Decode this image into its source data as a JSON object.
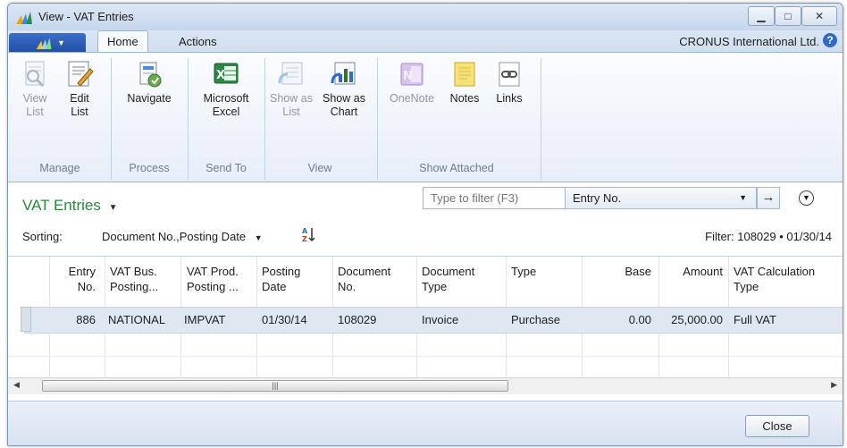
{
  "window": {
    "title": "View - VAT Entries"
  },
  "ribbon": {
    "tabs": [
      {
        "label": "Home"
      },
      {
        "label": "Actions"
      }
    ],
    "company": "CRONUS International Ltd.",
    "buttons": {
      "view_list": "View List",
      "edit_list": "Edit List",
      "navigate": "Navigate",
      "microsoft_excel": "Microsoft Excel",
      "show_as_list": "Show as List",
      "show_as_chart": "Show as Chart",
      "onenote": "OneNote",
      "notes": "Notes",
      "links": "Links"
    },
    "groups": {
      "manage": "Manage",
      "process": "Process",
      "send_to": "Send To",
      "view": "View",
      "show_attached": "Show Attached"
    }
  },
  "list": {
    "title": "VAT Entries",
    "filter_placeholder": "Type to filter (F3)",
    "filter_field": "Entry No.",
    "sorting_label": "Sorting:",
    "sorting_value": "Document No.,Posting Date",
    "filter_text": "Filter: 108029 • 01/30/14",
    "columns": [
      {
        "line1": "Entry",
        "line2": "No."
      },
      {
        "line1": "VAT Bus.",
        "line2": "Posting..."
      },
      {
        "line1": "VAT Prod.",
        "line2": "Posting ..."
      },
      {
        "line1": "Posting",
        "line2": "Date"
      },
      {
        "line1": "Document",
        "line2": "No."
      },
      {
        "line1": "Document",
        "line2": "Type"
      },
      {
        "line1": "Type",
        "line2": ""
      },
      {
        "line1": "Base",
        "line2": ""
      },
      {
        "line1": "Amount",
        "line2": ""
      },
      {
        "line1": "VAT Calculation",
        "line2": "Type"
      }
    ],
    "rows": [
      {
        "entry_no": "886",
        "vat_bus": "NATIONAL",
        "vat_prod": "IMPVAT",
        "posting_date": "01/30/14",
        "document_no": "108029",
        "document_type": "Invoice",
        "type": "Purchase",
        "base": "0.00",
        "amount": "25,000.00",
        "vat_calc_type": "Full VAT"
      }
    ]
  },
  "footer": {
    "close_label": "Close"
  },
  "colors": {
    "title_green": "#2b8a3e",
    "ribbon_blue": "#1f4ea5"
  }
}
